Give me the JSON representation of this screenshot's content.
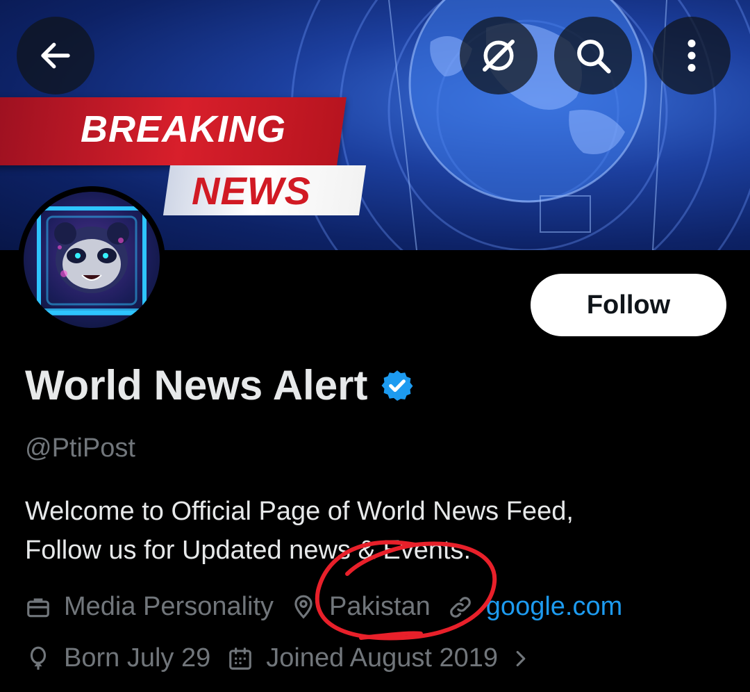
{
  "banner": {
    "breaking_label": "BREAKING",
    "news_label": "NEWS"
  },
  "header": {
    "back_icon": "arrow-left-icon",
    "grok_icon": "grok-icon",
    "search_icon": "search-icon",
    "more_icon": "more-vertical-icon"
  },
  "profile": {
    "display_name": "World News Alert",
    "handle": "@PtiPost",
    "verified_color": "#1d9bf0",
    "bio_line1": "Welcome to Official Page of World News Feed,",
    "bio_line2": "Follow us for Updated news & Events.",
    "category": "Media Personality",
    "location": "Pakistan",
    "website": "google.com",
    "birthday": "Born July 29",
    "joined": "Joined August 2019"
  },
  "actions": {
    "follow_label": "Follow"
  },
  "colors": {
    "background": "#000000",
    "link": "#1d9bf0",
    "secondary_text": "#71767b",
    "annotation": "#e8202a"
  }
}
